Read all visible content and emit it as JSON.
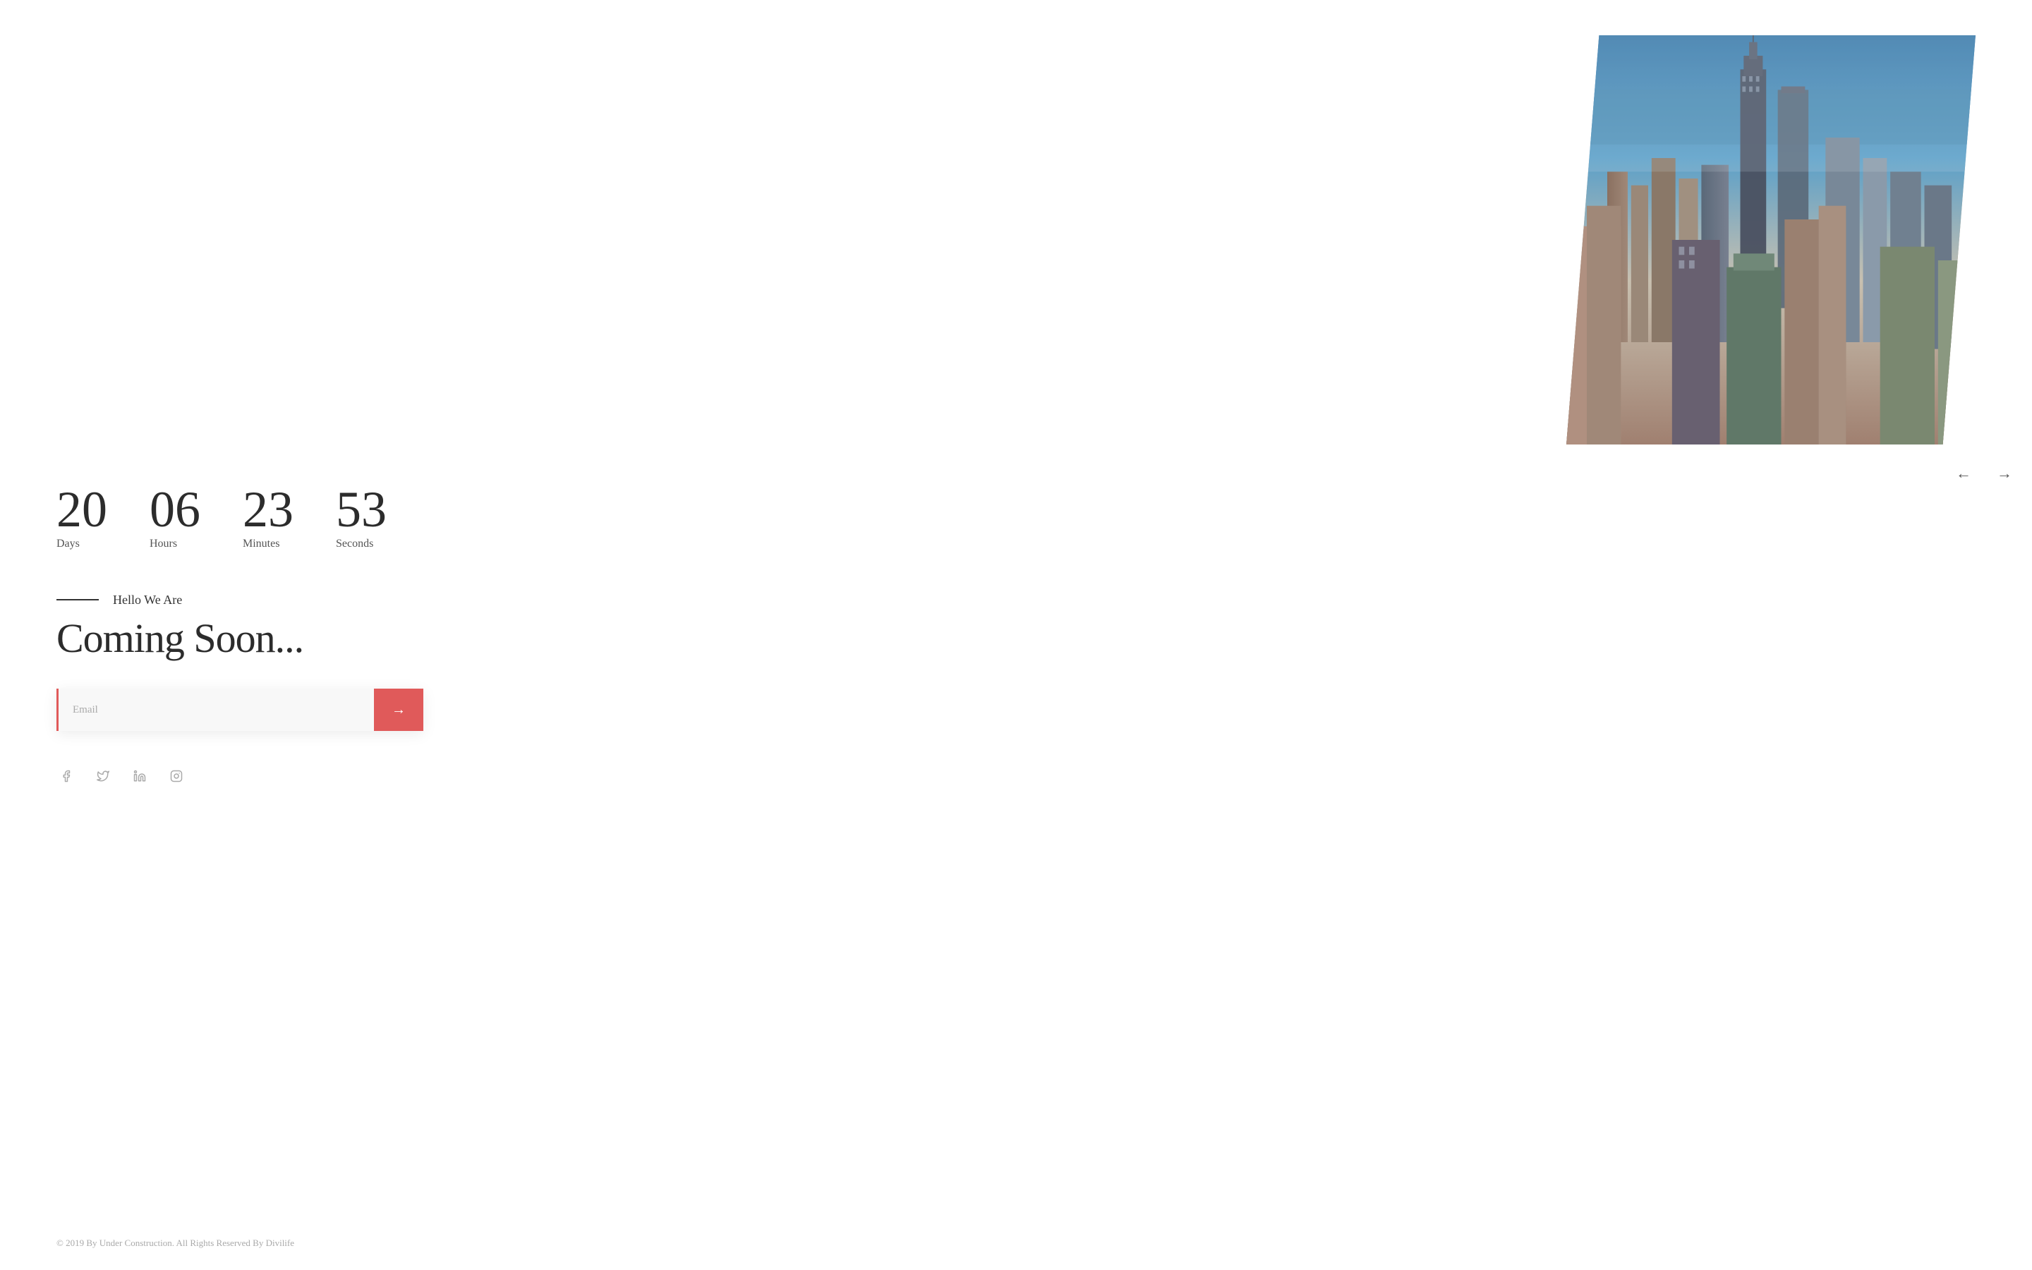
{
  "countdown": {
    "days": {
      "value": "20",
      "label": "Days"
    },
    "hours": {
      "value": "06",
      "label": "Hours"
    },
    "minutes": {
      "value": "23",
      "label": "Minutes"
    },
    "seconds": {
      "value": "53",
      "label": "Seconds"
    }
  },
  "hero": {
    "hello_line": "Hello We Are",
    "title": "Coming Soon...",
    "divider_visible": true
  },
  "email_form": {
    "placeholder": "Email",
    "submit_arrow": "→"
  },
  "social": {
    "facebook": "f",
    "twitter": "t",
    "linkedin": "in",
    "instagram": "ig"
  },
  "navigation": {
    "prev_arrow": "←",
    "next_arrow": "→"
  },
  "footer": {
    "copyright": "© 2019 By Under Construction. All Rights Reserved By Divilife"
  },
  "colors": {
    "accent": "#e05a5a",
    "text_dark": "#2c2c2c",
    "text_muted": "#aaa",
    "divider": "#333"
  }
}
